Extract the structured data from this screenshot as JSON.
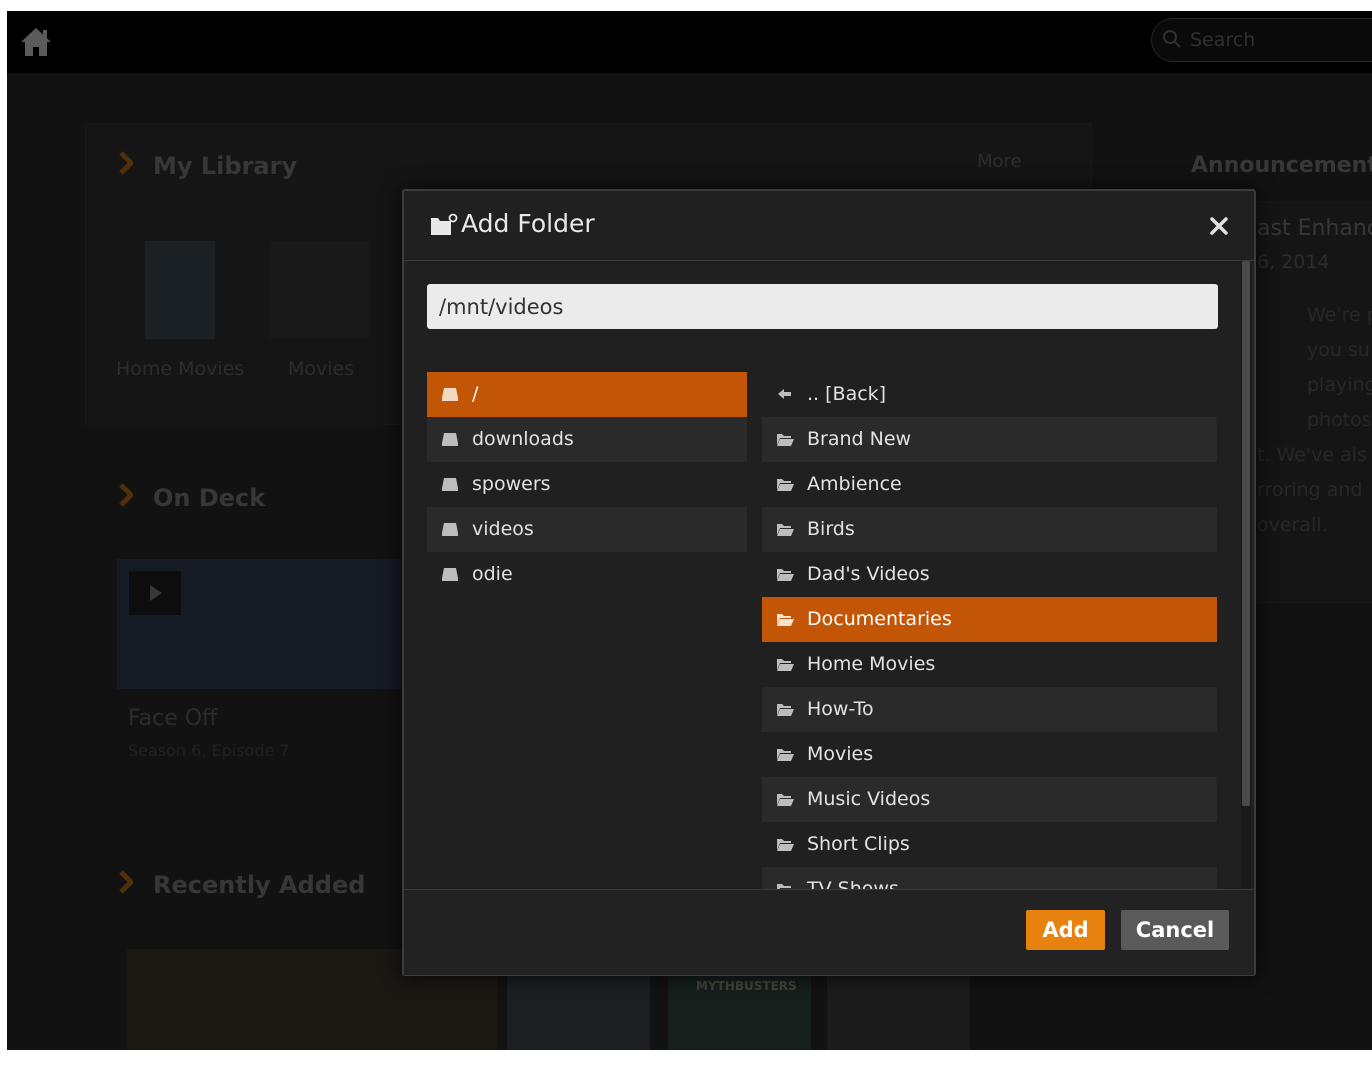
{
  "header": {
    "search_placeholder": "Search"
  },
  "background": {
    "my_library": {
      "title": "My Library",
      "toolbar_more": "More",
      "items": [
        "Home Movies",
        "Movies"
      ]
    },
    "announcements": {
      "title": "Announcements",
      "fragments": [
        "ast Enhanc",
        "6, 2014",
        "We're p",
        "you su",
        "playing",
        "photos",
        "t. We've als",
        "rroring and",
        "overall."
      ]
    },
    "on_deck": {
      "title": "On Deck",
      "item_title": "Face Off",
      "item_subtitle": "Season 6, Episode 7"
    },
    "recently_added": {
      "title": "Recently Added",
      "thumb_label": "MYTHBUSTERS"
    }
  },
  "dialog": {
    "title": "Add Folder",
    "path_value": "/mnt/videos",
    "drives": [
      {
        "label": "/",
        "selected": true
      },
      {
        "label": "downloads",
        "selected": false
      },
      {
        "label": "spowers",
        "selected": false
      },
      {
        "label": "videos",
        "selected": false
      },
      {
        "label": "odie",
        "selected": false
      }
    ],
    "back_label": ".. [Back]",
    "folders": [
      {
        "label": "Brand New",
        "selected": false
      },
      {
        "label": "Ambience",
        "selected": false
      },
      {
        "label": "Birds",
        "selected": false
      },
      {
        "label": "Dad's Videos",
        "selected": false
      },
      {
        "label": "Documentaries",
        "selected": true
      },
      {
        "label": "Home Movies",
        "selected": false
      },
      {
        "label": "How-To",
        "selected": false
      },
      {
        "label": "Movies",
        "selected": false
      },
      {
        "label": "Music Videos",
        "selected": false
      },
      {
        "label": "Short Clips",
        "selected": false
      },
      {
        "label": "TV Shows",
        "selected": false
      }
    ],
    "add_label": "Add",
    "cancel_label": "Cancel"
  },
  "colors": {
    "accent": "#c35507",
    "add_button": "#e8820e",
    "heading_chevron": "#b8660a"
  }
}
